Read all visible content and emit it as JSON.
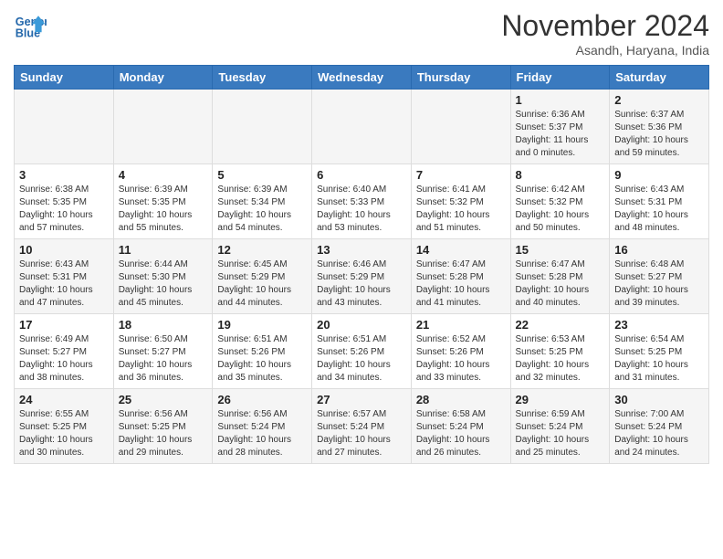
{
  "header": {
    "logo_line1": "General",
    "logo_line2": "Blue",
    "month": "November 2024",
    "location": "Asandh, Haryana, India"
  },
  "weekdays": [
    "Sunday",
    "Monday",
    "Tuesday",
    "Wednesday",
    "Thursday",
    "Friday",
    "Saturday"
  ],
  "weeks": [
    [
      {
        "day": "",
        "info": ""
      },
      {
        "day": "",
        "info": ""
      },
      {
        "day": "",
        "info": ""
      },
      {
        "day": "",
        "info": ""
      },
      {
        "day": "",
        "info": ""
      },
      {
        "day": "1",
        "info": "Sunrise: 6:36 AM\nSunset: 5:37 PM\nDaylight: 11 hours\nand 0 minutes."
      },
      {
        "day": "2",
        "info": "Sunrise: 6:37 AM\nSunset: 5:36 PM\nDaylight: 10 hours\nand 59 minutes."
      }
    ],
    [
      {
        "day": "3",
        "info": "Sunrise: 6:38 AM\nSunset: 5:35 PM\nDaylight: 10 hours\nand 57 minutes."
      },
      {
        "day": "4",
        "info": "Sunrise: 6:39 AM\nSunset: 5:35 PM\nDaylight: 10 hours\nand 55 minutes."
      },
      {
        "day": "5",
        "info": "Sunrise: 6:39 AM\nSunset: 5:34 PM\nDaylight: 10 hours\nand 54 minutes."
      },
      {
        "day": "6",
        "info": "Sunrise: 6:40 AM\nSunset: 5:33 PM\nDaylight: 10 hours\nand 53 minutes."
      },
      {
        "day": "7",
        "info": "Sunrise: 6:41 AM\nSunset: 5:32 PM\nDaylight: 10 hours\nand 51 minutes."
      },
      {
        "day": "8",
        "info": "Sunrise: 6:42 AM\nSunset: 5:32 PM\nDaylight: 10 hours\nand 50 minutes."
      },
      {
        "day": "9",
        "info": "Sunrise: 6:43 AM\nSunset: 5:31 PM\nDaylight: 10 hours\nand 48 minutes."
      }
    ],
    [
      {
        "day": "10",
        "info": "Sunrise: 6:43 AM\nSunset: 5:31 PM\nDaylight: 10 hours\nand 47 minutes."
      },
      {
        "day": "11",
        "info": "Sunrise: 6:44 AM\nSunset: 5:30 PM\nDaylight: 10 hours\nand 45 minutes."
      },
      {
        "day": "12",
        "info": "Sunrise: 6:45 AM\nSunset: 5:29 PM\nDaylight: 10 hours\nand 44 minutes."
      },
      {
        "day": "13",
        "info": "Sunrise: 6:46 AM\nSunset: 5:29 PM\nDaylight: 10 hours\nand 43 minutes."
      },
      {
        "day": "14",
        "info": "Sunrise: 6:47 AM\nSunset: 5:28 PM\nDaylight: 10 hours\nand 41 minutes."
      },
      {
        "day": "15",
        "info": "Sunrise: 6:47 AM\nSunset: 5:28 PM\nDaylight: 10 hours\nand 40 minutes."
      },
      {
        "day": "16",
        "info": "Sunrise: 6:48 AM\nSunset: 5:27 PM\nDaylight: 10 hours\nand 39 minutes."
      }
    ],
    [
      {
        "day": "17",
        "info": "Sunrise: 6:49 AM\nSunset: 5:27 PM\nDaylight: 10 hours\nand 38 minutes."
      },
      {
        "day": "18",
        "info": "Sunrise: 6:50 AM\nSunset: 5:27 PM\nDaylight: 10 hours\nand 36 minutes."
      },
      {
        "day": "19",
        "info": "Sunrise: 6:51 AM\nSunset: 5:26 PM\nDaylight: 10 hours\nand 35 minutes."
      },
      {
        "day": "20",
        "info": "Sunrise: 6:51 AM\nSunset: 5:26 PM\nDaylight: 10 hours\nand 34 minutes."
      },
      {
        "day": "21",
        "info": "Sunrise: 6:52 AM\nSunset: 5:26 PM\nDaylight: 10 hours\nand 33 minutes."
      },
      {
        "day": "22",
        "info": "Sunrise: 6:53 AM\nSunset: 5:25 PM\nDaylight: 10 hours\nand 32 minutes."
      },
      {
        "day": "23",
        "info": "Sunrise: 6:54 AM\nSunset: 5:25 PM\nDaylight: 10 hours\nand 31 minutes."
      }
    ],
    [
      {
        "day": "24",
        "info": "Sunrise: 6:55 AM\nSunset: 5:25 PM\nDaylight: 10 hours\nand 30 minutes."
      },
      {
        "day": "25",
        "info": "Sunrise: 6:56 AM\nSunset: 5:25 PM\nDaylight: 10 hours\nand 29 minutes."
      },
      {
        "day": "26",
        "info": "Sunrise: 6:56 AM\nSunset: 5:24 PM\nDaylight: 10 hours\nand 28 minutes."
      },
      {
        "day": "27",
        "info": "Sunrise: 6:57 AM\nSunset: 5:24 PM\nDaylight: 10 hours\nand 27 minutes."
      },
      {
        "day": "28",
        "info": "Sunrise: 6:58 AM\nSunset: 5:24 PM\nDaylight: 10 hours\nand 26 minutes."
      },
      {
        "day": "29",
        "info": "Sunrise: 6:59 AM\nSunset: 5:24 PM\nDaylight: 10 hours\nand 25 minutes."
      },
      {
        "day": "30",
        "info": "Sunrise: 7:00 AM\nSunset: 5:24 PM\nDaylight: 10 hours\nand 24 minutes."
      }
    ]
  ]
}
